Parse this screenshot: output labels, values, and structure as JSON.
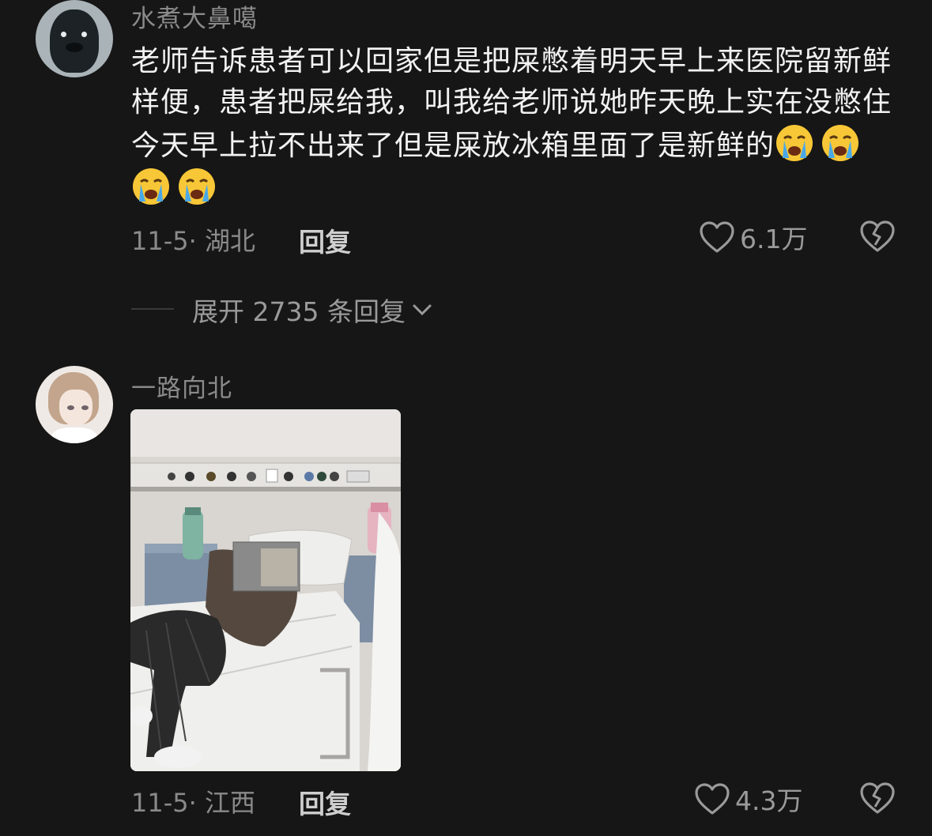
{
  "comments": [
    {
      "username": "水煮大鼻噶",
      "avatar_icon": "seal-avatar",
      "text": "老师告诉患者可以回家但是把屎憋着明天早上来医院留新鲜样便，患者把屎给我，叫我给老师说她昨天晚上实在没憋住今天早上拉不出来了但是屎放冰箱里面了是新鲜的",
      "emoji_icons": [
        "crying-face-icon",
        "crying-face-icon",
        "crying-face-icon",
        "crying-face-icon"
      ],
      "date_location": "11-5· 湖北",
      "reply_label": "回复",
      "likes": "6.1万"
    },
    {
      "username": "一路向北",
      "avatar_icon": "anime-avatar",
      "image_icon": "hospital-photo",
      "date_location": "11-5· 江西",
      "reply_label": "回复",
      "likes": "4.3万"
    }
  ],
  "expand_replies": "展开 2735 条回复",
  "colors": {
    "background": "#161616",
    "text_primary": "#f2f2f2",
    "text_secondary": "#8a8a8a"
  }
}
